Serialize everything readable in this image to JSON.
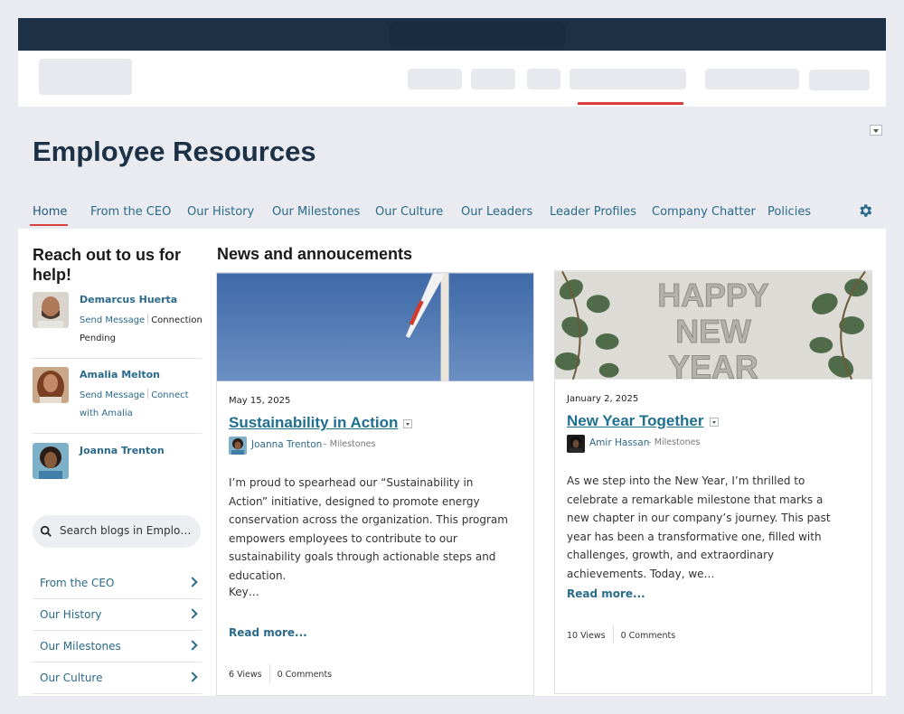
{
  "page": {
    "title": "Employee Resources"
  },
  "nav": {
    "tabs": [
      {
        "label": "Home",
        "active": true
      },
      {
        "label": "From the CEO"
      },
      {
        "label": "Our History"
      },
      {
        "label": "Our Milestones"
      },
      {
        "label": "Our Culture"
      },
      {
        "label": "Our Leaders"
      },
      {
        "label": "Leader Profiles"
      },
      {
        "label": "Company Chatter"
      },
      {
        "label": "Policies"
      }
    ],
    "settings_icon": "gear-icon"
  },
  "sidebar": {
    "title": "Reach out to us for help!",
    "people": [
      {
        "name": "Demarcus Huerta",
        "action1": "Send Message",
        "action2": "Connection Pending"
      },
      {
        "name": "Amalia Melton",
        "action1": "Send Message",
        "action2": "Connect with Amalia"
      },
      {
        "name": "Joanna Trenton"
      }
    ],
    "search_placeholder": "Search blogs in Emplo…",
    "links": [
      "From the CEO",
      "Our History",
      "Our Milestones",
      "Our Culture"
    ]
  },
  "news": {
    "title": "News and annoucements",
    "posts": [
      {
        "date": "May 15, 2025",
        "title": "Sustainability in Action",
        "author": "Joanna Trenton",
        "category": "– Milestones",
        "body": "I’m proud to spearhead our “Sustainability in Action” initiative, designed to promote energy conservation across the organization. This program empowers employees to contribute to our sustainability goals through actionable steps and education.",
        "body2": "Key…",
        "read_more": "Read more...",
        "views": "6 Views",
        "comments": "0 Comments"
      },
      {
        "date": "January 2, 2025",
        "title": "New Year Together",
        "author": "Amir Hassan",
        "category": "– Milestones",
        "image_text": [
          "HAPPY",
          "NEW",
          "YEAR"
        ],
        "body": "As we step into the New Year, I’m thrilled to celebrate a remarkable milestone that marks a new chapter in our company’s journey. This past year has been a transformative one, filled with challenges, growth, and extraordinary achievements. Today, we…",
        "read_more": "Read more...",
        "views": "10 Views",
        "comments": "0 Comments"
      }
    ]
  },
  "colors": {
    "brand_dark": "#1c3146",
    "link": "#2a6a8a",
    "accent": "#d9423a"
  }
}
